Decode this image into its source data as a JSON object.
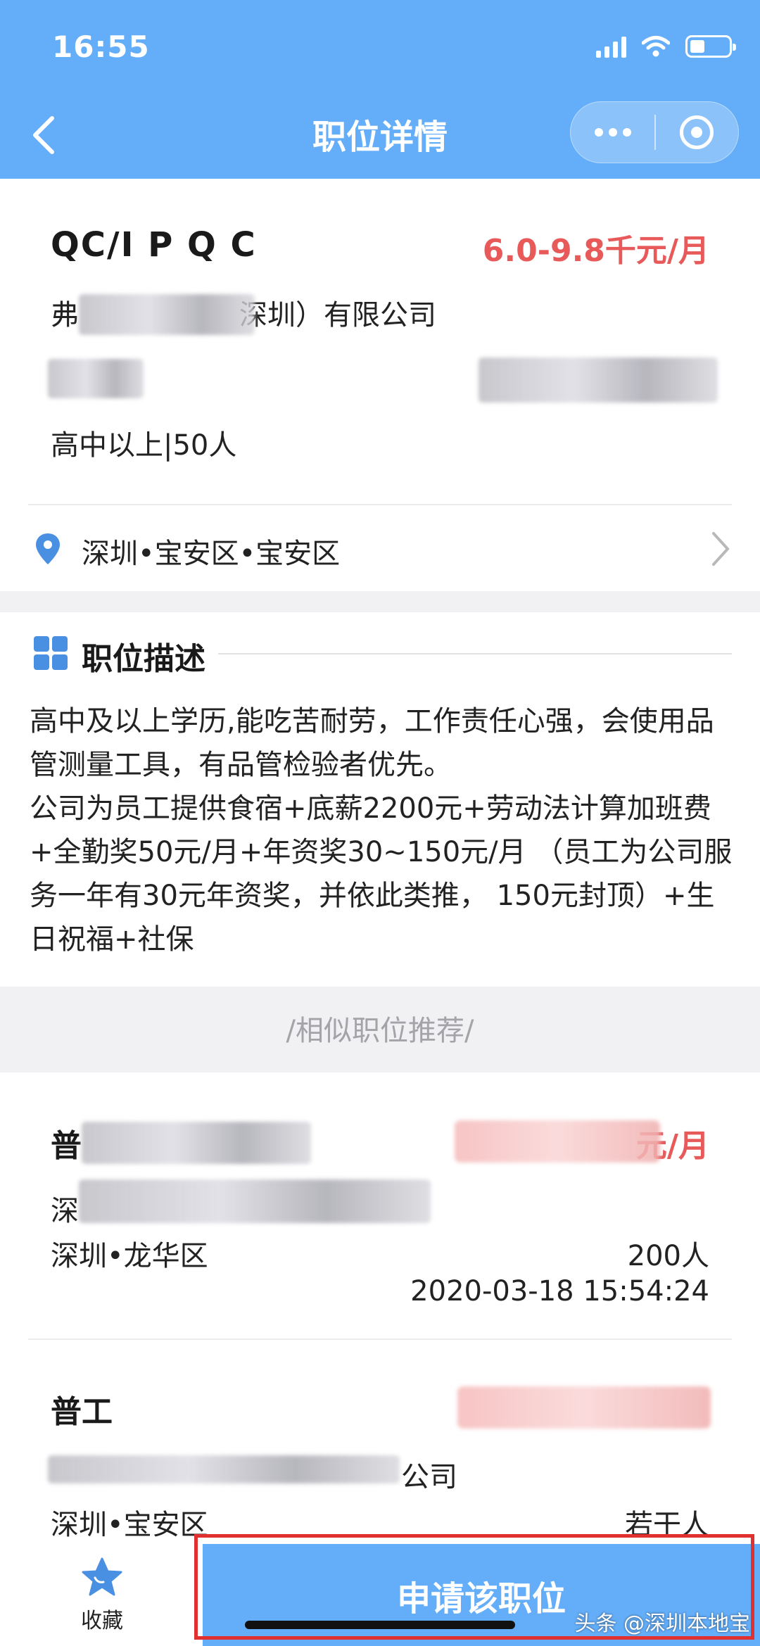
{
  "status_bar": {
    "time": "16:55"
  },
  "nav": {
    "title": "职位详情"
  },
  "job": {
    "title": "QC/I P Q C",
    "salary": "6.0-9.8千元/月",
    "company_visible_start": "弗",
    "company_visible_end": "深圳）有限公司",
    "requirements": "高中以上|50人",
    "location": "深圳•宝安区•宝安区"
  },
  "description": {
    "title": "职位描述",
    "paragraphs": [
      "高中及以上学历,能吃苦耐劳，工作责任心强，会使用品管测量工具，有品管检验者优先。",
      "公司为员工提供食宿+底薪2200元+劳动法计算加班费+全勤奖50元/月+年资奖30~150元/月 （员工为公司服务一年有30元年资奖，并依此类推， 150元封顶）+生日祝福+社保"
    ]
  },
  "similar": {
    "heading": "/相似职位推荐/",
    "items": [
      {
        "title": "普",
        "salary_tail": "元/月",
        "company_start": "深",
        "location": "深圳•龙华区",
        "headcount": "200人",
        "timestamp": "2020-03-18 15:54:24"
      },
      {
        "title": "普工",
        "company_tail": "公司",
        "location": "深圳•宝安区",
        "headcount": "若干人"
      }
    ]
  },
  "bottom": {
    "favorite_label": "收藏",
    "apply_label": "申请该职位",
    "watermark": "头条 @深圳本地宝"
  },
  "colors": {
    "header_blue": "#64aef9",
    "salary_red": "#e85a5a",
    "icon_blue": "#4a90e2",
    "highlight_red": "#e03030"
  }
}
